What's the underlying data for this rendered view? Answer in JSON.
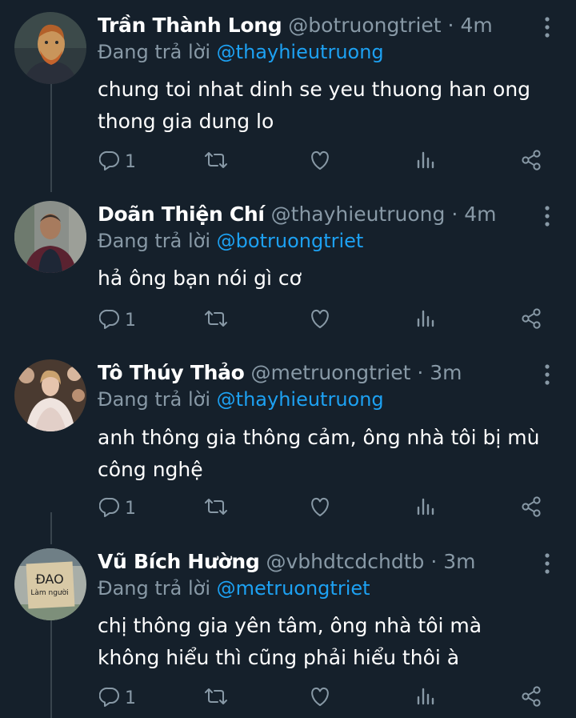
{
  "tweets": [
    {
      "name": "Trần Thành Long",
      "handle": "@botruongtriet",
      "time": "4m",
      "reply_prefix": "Đang trả lời",
      "reply_to": "@thayhieutruong",
      "text": "chung toi nhat dinh se yeu thuong han ong thong gia dung lo",
      "reply_count": "1"
    },
    {
      "name": "Doãn Thiện Chí",
      "handle": "@thayhieutruong",
      "time": "4m",
      "reply_prefix": "Đang trả lời",
      "reply_to": "@botruongtriet",
      "text": "hả ông bạn nói gì cơ",
      "reply_count": "1"
    },
    {
      "name": "Tô Thúy Thảo",
      "handle": "@metruongtriet",
      "time": "3m",
      "reply_prefix": "Đang trả lời",
      "reply_to": "@thayhieutruong",
      "text": "anh thông gia thông cảm, ông nhà tôi bị mù công nghệ",
      "reply_count": "1"
    },
    {
      "name": "Vũ Bích Hường",
      "handle": "@vbhdtcdchdtb",
      "time": "3m",
      "reply_prefix": "Đang trả lời",
      "reply_to": "@metruongtriet",
      "text": "chị thông gia yên tâm, ông nhà tôi mà không hiểu thì cũng phải hiểu thôi à",
      "reply_count": "1"
    }
  ],
  "avatar4_sign": {
    "line1": "ĐAO",
    "line2": "Làm người"
  },
  "separator": "·",
  "colors": {
    "background": "#15202b",
    "muted": "#8899a6",
    "link": "#1da1f2",
    "thread_line": "#38444d"
  },
  "icons": [
    "reply-icon",
    "retweet-icon",
    "like-icon",
    "analytics-icon",
    "share-icon",
    "more-icon"
  ]
}
